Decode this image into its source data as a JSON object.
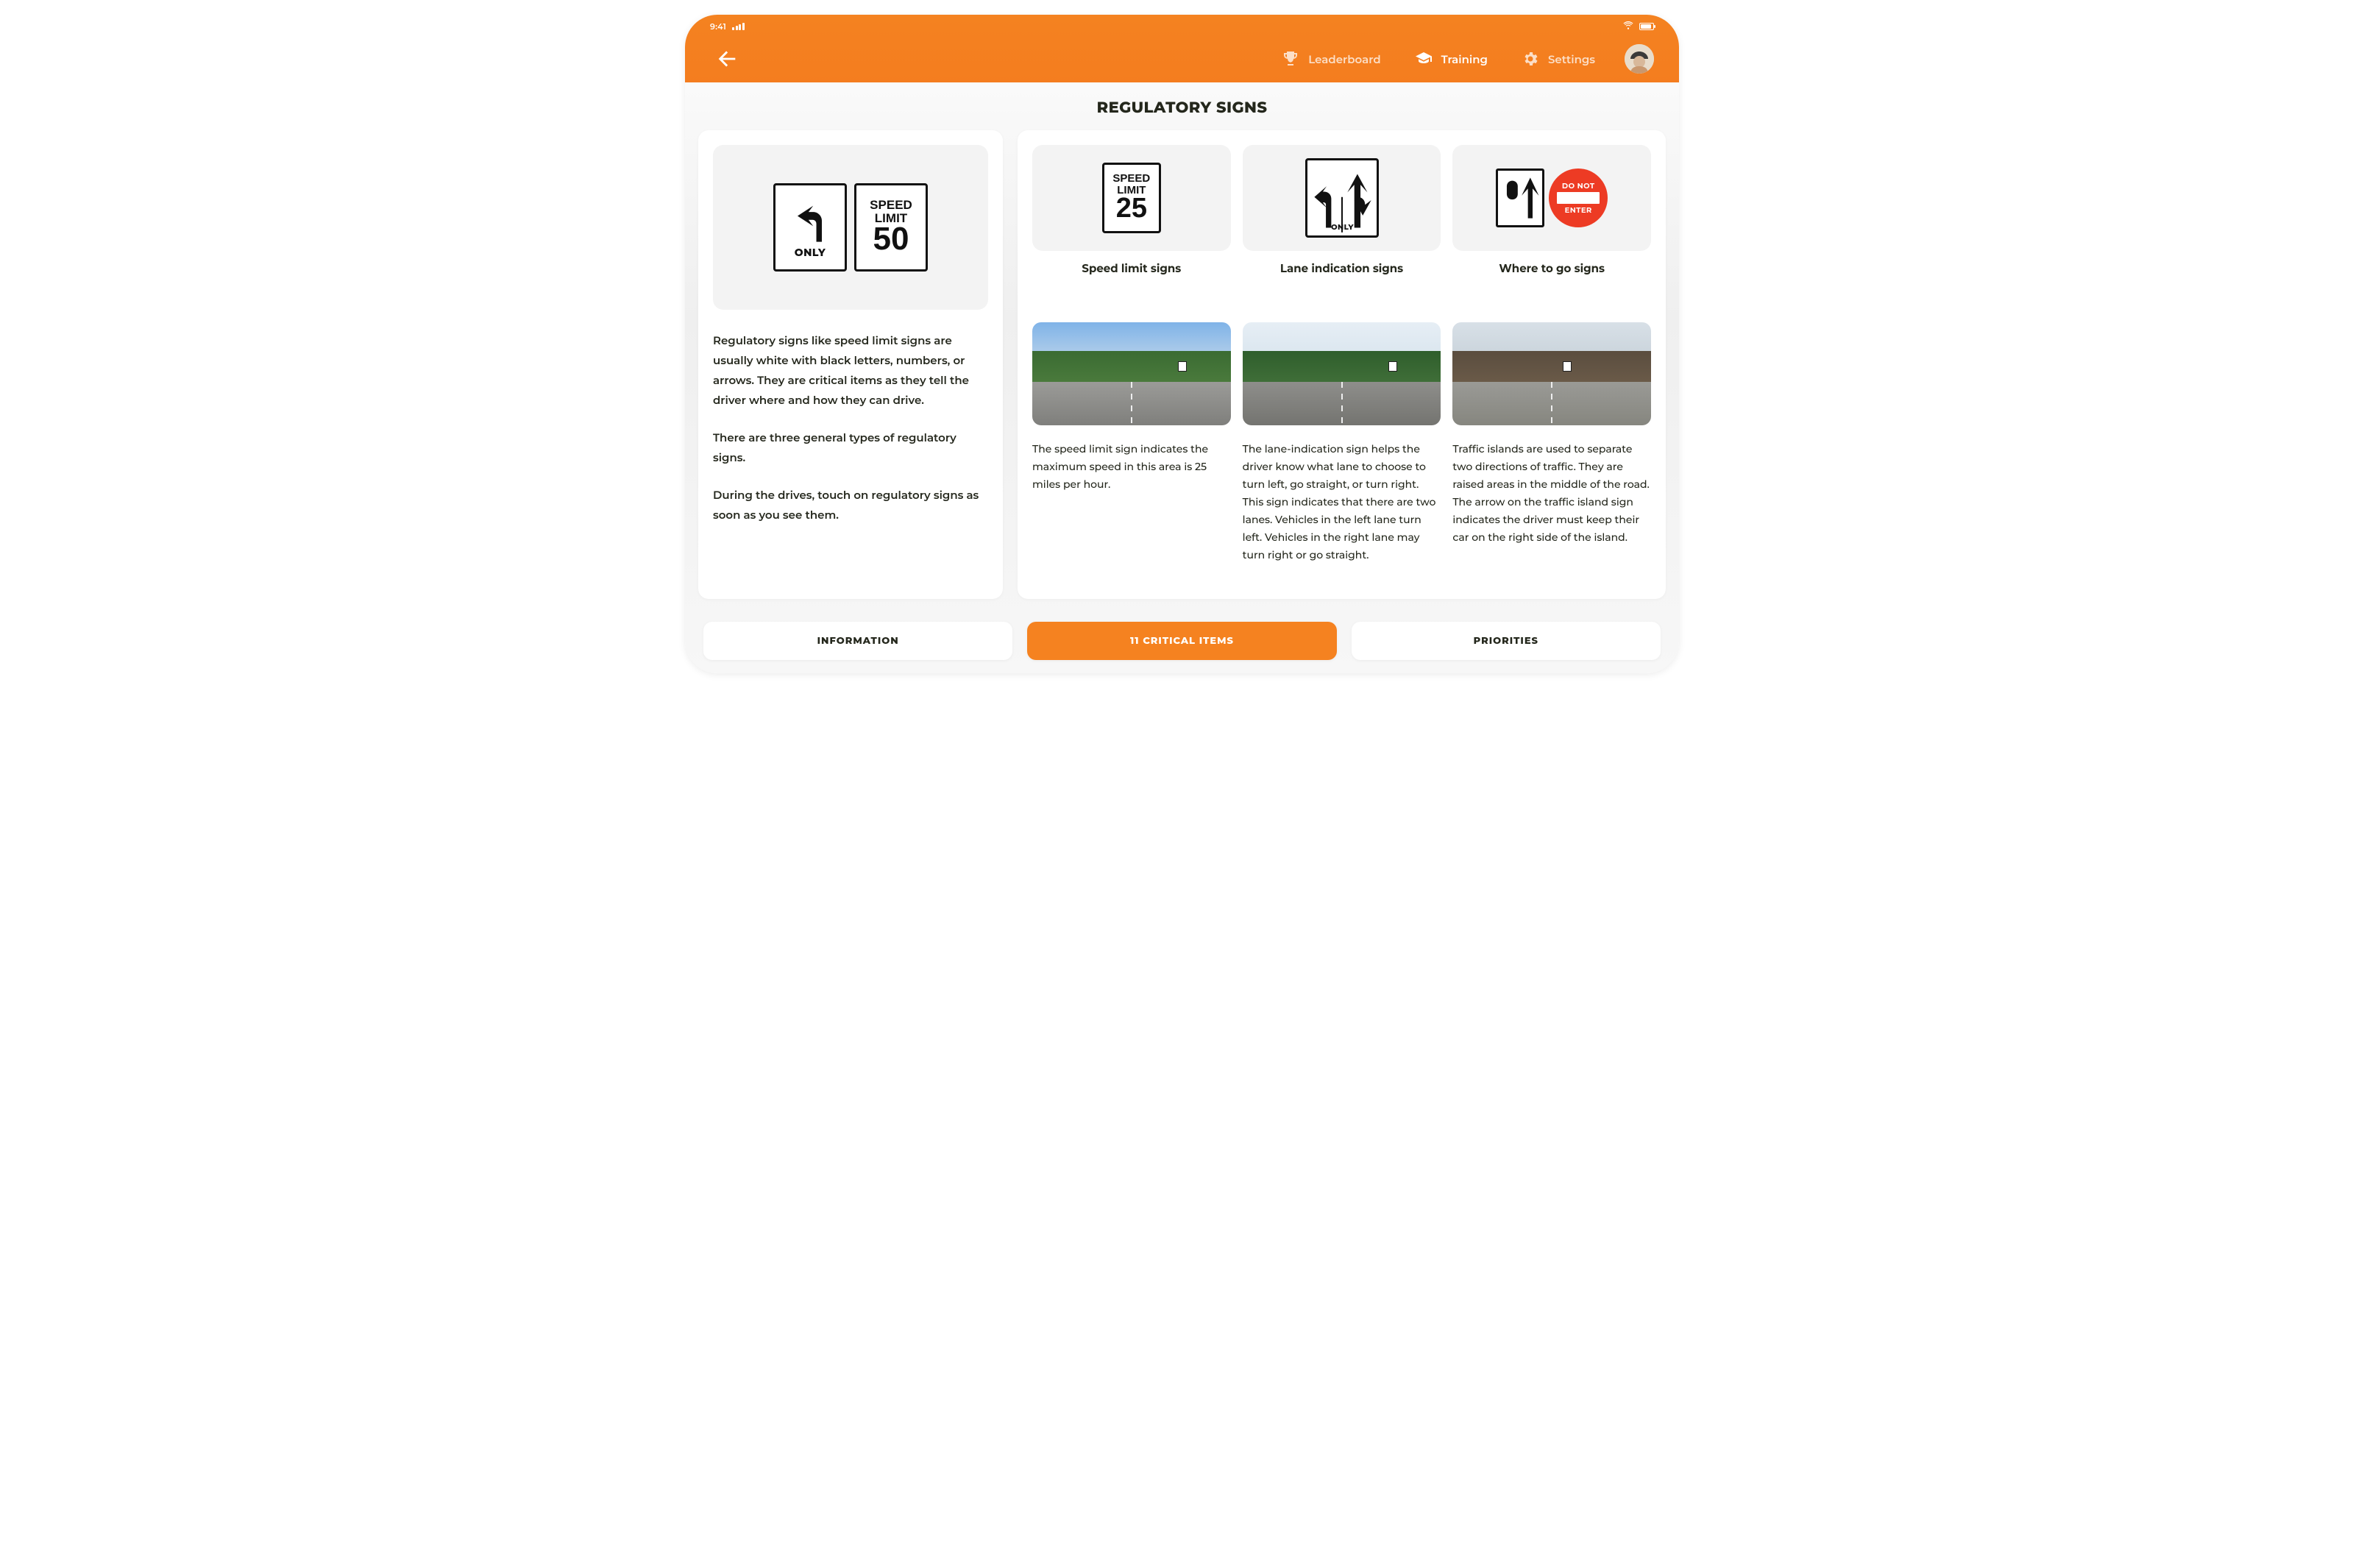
{
  "status": {
    "time": "9:41"
  },
  "nav": {
    "items": [
      {
        "id": "leaderboard",
        "label": "Leaderboard",
        "active": false
      },
      {
        "id": "training",
        "label": "Training",
        "active": true
      },
      {
        "id": "settings",
        "label": "Settings",
        "active": false
      }
    ]
  },
  "page": {
    "title": "REGULATORY SIGNS"
  },
  "intro": {
    "sign_only_label": "ONLY",
    "sign_speed_top": "SPEED",
    "sign_speed_mid": "LIMIT",
    "sign_speed_value": "50",
    "paragraphs": [
      "Regulatory signs like speed limit signs are usually white with black letters, numbers, or arrows. They are critical items as they tell the driver where and how they can drive.",
      "There are three general types of regulatory signs.",
      "During the drives, touch on regulatory signs as soon as you see them."
    ]
  },
  "types": {
    "cards": [
      {
        "label": "Speed limit signs",
        "speed_top": "SPEED",
        "speed_mid": "LIMIT",
        "speed_value": "25"
      },
      {
        "label": "Lane indication signs",
        "only_label": "ONLY"
      },
      {
        "label": "Where to go signs",
        "dne_top": "DO NOT",
        "dne_bottom": "ENTER"
      }
    ]
  },
  "examples": [
    {
      "text": "The speed limit sign indicates the maximum speed in this area is 25 miles per hour."
    },
    {
      "text": "The lane-indication sign helps the driver know what lane to choose to turn left, go straight, or turn right. This sign indicates that there are two lanes. Vehicles in the left lane turn left. Vehicles in the right lane may turn right or go straight."
    },
    {
      "text": "Traffic islands are used to separate two directions of traffic. They are raised areas in the middle of the road. The arrow on the traffic island sign indicates the driver must keep their car on the right side of the island."
    }
  ],
  "tabs": [
    {
      "label": "INFORMATION",
      "active": false
    },
    {
      "label": "11 CRITICAL ITEMS",
      "active": true
    },
    {
      "label": "PRIORITIES",
      "active": false
    }
  ]
}
